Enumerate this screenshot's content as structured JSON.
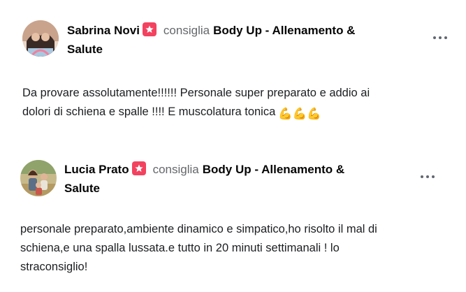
{
  "reviews": [
    {
      "author": "Sabrina Novi",
      "verb": "consiglia",
      "page_line1": "Body Up - Allenamento &",
      "page_line2": "Salute",
      "text_line1": "Da provare assolutamente!!!!!! Personale super preparato e addio ai",
      "text_line2": "dolori di schiena e spalle !!!! E muscolatura tonica",
      "emoji": "💪💪💪",
      "recommend_icon": "recommend-icon",
      "more_icon": "more-options-icon"
    },
    {
      "author": "Lucia Prato",
      "verb": "consiglia",
      "page_line1": "Body Up - Allenamento &",
      "page_line2": "Salute",
      "text_line1": "personale preparato,ambiente dinamico e simpatico,ho risolto il mal di",
      "text_line2": "schiena,e una spalla lussata.e tutto in 20 minuti settimanali ! lo",
      "text_line3": "straconsiglio!",
      "recommend_icon": "recommend-icon",
      "more_icon": "more-options-icon"
    }
  ],
  "colors": {
    "recommend": "#f3425f",
    "secondary_text": "#65676b",
    "text": "#050505"
  }
}
